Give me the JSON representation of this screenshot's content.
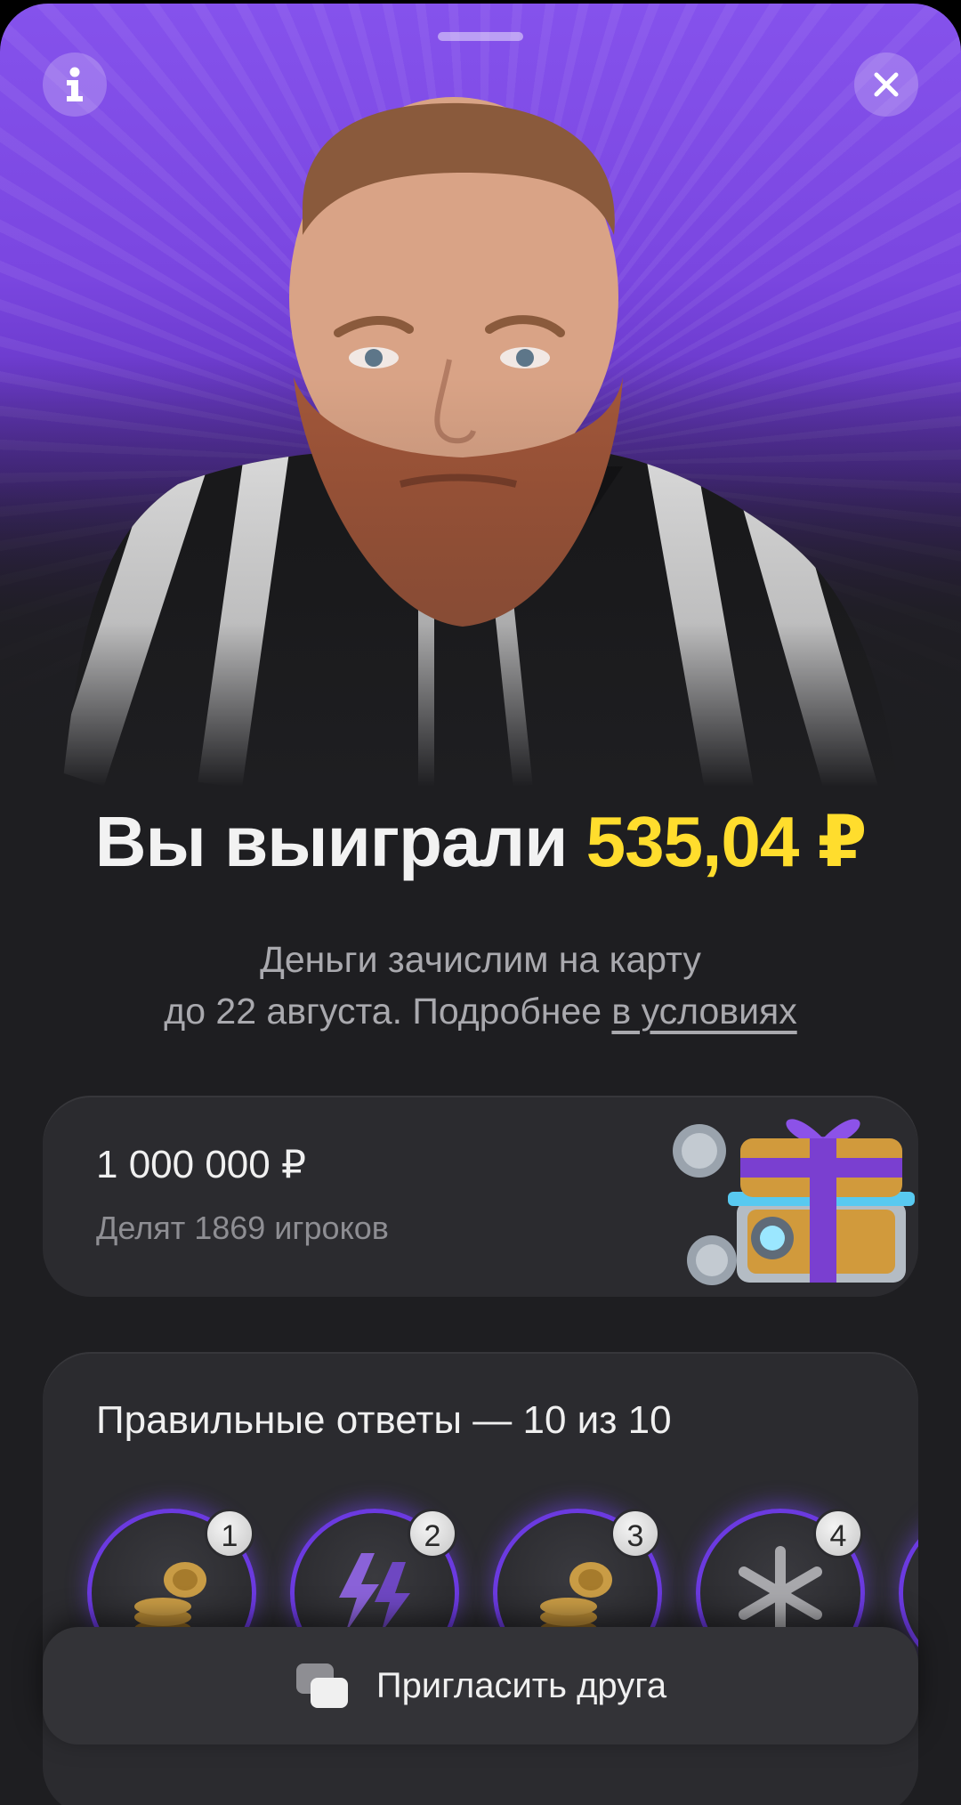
{
  "header": {
    "info_icon": "info-icon",
    "close_icon": "close-icon"
  },
  "result": {
    "title_prefix": "Вы выиграли",
    "amount": "535,04 ₽",
    "subtitle_line1": "Деньги зачислим на карту",
    "subtitle_line2": "до 22 августа. Подробнее ",
    "terms_link": "в условиях"
  },
  "prize": {
    "amount": "1 000 000 ₽",
    "shared_by": "Делят 1869 игроков",
    "image_icon": "gift-chest-icon"
  },
  "answers": {
    "title": "Правильные ответы — 10 из 10",
    "items": [
      {
        "number": "1",
        "icon": "coins-icon"
      },
      {
        "number": "2",
        "icon": "lightning-icon"
      },
      {
        "number": "3",
        "icon": "coins-icon"
      },
      {
        "number": "4",
        "icon": "snowflake-icon"
      }
    ]
  },
  "actions": {
    "invite_label": "Пригласить друга",
    "invite_icon": "copy-icon"
  },
  "colors": {
    "accent_purple": "#7a46e0",
    "amount_yellow": "#ffdd2d",
    "background": "#1e1e21",
    "card": "#2b2b2f"
  }
}
